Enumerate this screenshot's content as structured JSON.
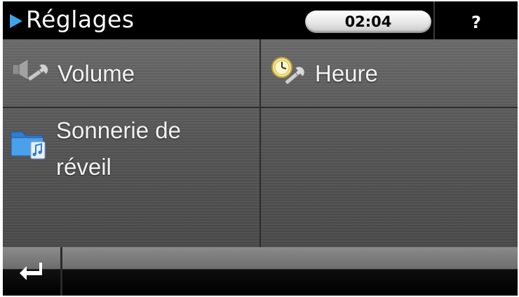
{
  "header": {
    "title": "Réglages",
    "clock": "02:04",
    "help_label": "?"
  },
  "menu": {
    "items": [
      {
        "label": "Volume",
        "icon": "speaker-wrench-icon"
      },
      {
        "label": "Heure",
        "icon": "clock-wrench-icon"
      },
      {
        "label": "Sonnerie de réveil",
        "icon": "music-folder-icon"
      }
    ]
  },
  "footer": {
    "back_icon": "return-arrow-icon"
  },
  "colors": {
    "accent": "#3fa2e8",
    "header_bg": "#000000",
    "panel_bg": "#5a5a5a",
    "text": "#f2f2f2"
  }
}
